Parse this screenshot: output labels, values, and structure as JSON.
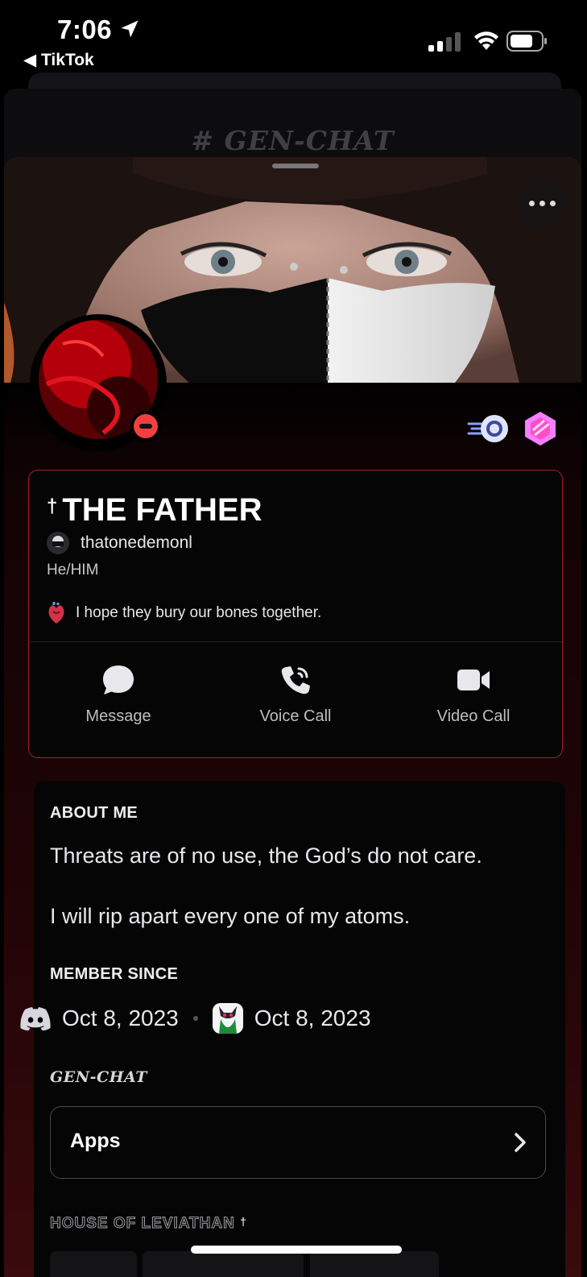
{
  "status_bar": {
    "time": "7:06",
    "back_app": "◀ TikTok"
  },
  "header": {
    "channel_title": "# GEN-CHAT"
  },
  "profile": {
    "cross_symbol": "†",
    "display_name": "THE FATHER",
    "username": "thatonedemonl",
    "pronouns": "He/HIM",
    "custom_status": "I hope they bury our bones together.",
    "status_indicator": "do-not-disturb",
    "badges": [
      "nitro-badge-icon",
      "server-boost-badge-icon"
    ]
  },
  "actions": [
    {
      "label": "Message",
      "icon": "chat-bubble-icon"
    },
    {
      "label": "Voice Call",
      "icon": "phone-icon"
    },
    {
      "label": "Video Call",
      "icon": "video-camera-icon"
    }
  ],
  "about": {
    "heading": "ABOUT ME",
    "lines": [
      "Threats are of no use, the God’s do not care.",
      "I will rip apart every one of my atoms."
    ]
  },
  "member_since": {
    "heading": "MEMBER SINCE",
    "discord_date": "Oct 8, 2023",
    "server_date": "Oct 8, 2023"
  },
  "server": {
    "name": "GEN-CHAT",
    "apps_label": "Apps",
    "role_heading": "HOUSE OF LEVIATHAN",
    "role_mark": "†"
  },
  "colors": {
    "accent_border": "#a51d2c",
    "dnd": "#f23f42",
    "boost": "#f47fff",
    "background": "#000000"
  }
}
